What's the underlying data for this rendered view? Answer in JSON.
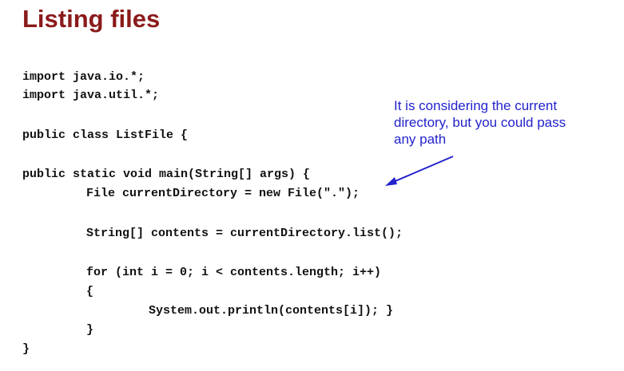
{
  "slide": {
    "title": "Listing files",
    "code_lines": [
      "import java.io.*;",
      "import java.util.*;",
      "public class ListFile {",
      "public static void main(String[] args) {",
      "File currentDirectory = new File(\".\");",
      "String[] contents = currentDirectory.list();",
      "for (int i = 0; i < contents.length; i++)",
      "{",
      "System.out.println(contents[i]); }",
      "}",
      "}"
    ],
    "annotation": {
      "lines": [
        "It is considering the current",
        "directory, but you could pass",
        "any path"
      ]
    },
    "colors": {
      "title": "#8b1a1a",
      "code": "#111111",
      "annotation": "#2222cc"
    },
    "arrow_icon": "arrow-pointing-to-dot-argument"
  }
}
